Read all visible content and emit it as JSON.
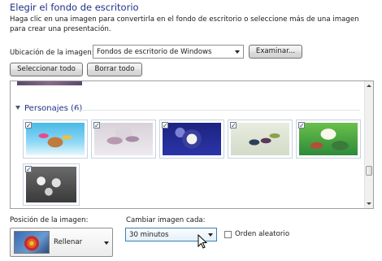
{
  "header": {
    "title": "Elegir el fondo de escritorio",
    "description": "Haga clic en una imagen para convertirla en el fondo de escritorio o seleccione más de una imagen para crear una presentación."
  },
  "location": {
    "label": "Ubicación de la imagen:",
    "value": "Fondos de escritorio de Windows",
    "browse_button": "Examinar..."
  },
  "actions": {
    "select_all": "Seleccionar todo",
    "clear_all": "Borrar todo"
  },
  "gallery": {
    "group_label": "Personajes (6)",
    "items": [
      {
        "name": "thumb-1",
        "checked": true
      },
      {
        "name": "thumb-2",
        "checked": true
      },
      {
        "name": "thumb-3",
        "checked": true
      },
      {
        "name": "thumb-4",
        "checked": true
      },
      {
        "name": "thumb-5",
        "checked": true
      },
      {
        "name": "thumb-6",
        "checked": true
      }
    ]
  },
  "position": {
    "label": "Posición de la imagen:",
    "value": "Rellenar"
  },
  "interval": {
    "label": "Cambiar imagen cada:",
    "value": "30 minutos"
  },
  "shuffle": {
    "label": "Orden aleatorio",
    "checked": false
  }
}
